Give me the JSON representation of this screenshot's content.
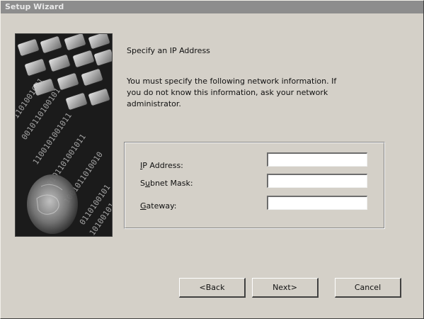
{
  "window": {
    "title": "Setup Wizard"
  },
  "sidebar": {
    "image_label": "wizard-banner-image"
  },
  "page": {
    "heading": "Specify an IP Address",
    "description": "You must specify the following network information.  If\nyou do not know this information, ask your network\nadministrator."
  },
  "fields": {
    "ip_address": {
      "label_pre": "",
      "label_hot": "I",
      "label_post": "P Address:",
      "value": ""
    },
    "subnet_mask": {
      "label_pre": "S",
      "label_hot": "u",
      "label_post": "bnet Mask:",
      "value": ""
    },
    "gateway": {
      "label_pre": "",
      "label_hot": "G",
      "label_post": "ateway:",
      "value": ""
    }
  },
  "buttons": {
    "back": "<Back",
    "next": "Next>",
    "cancel": "Cancel"
  },
  "colors": {
    "dialog_bg": "#d4d0c8",
    "titlebar_bg": "#8d8d8d",
    "titlebar_text": "#e8e8e8"
  }
}
